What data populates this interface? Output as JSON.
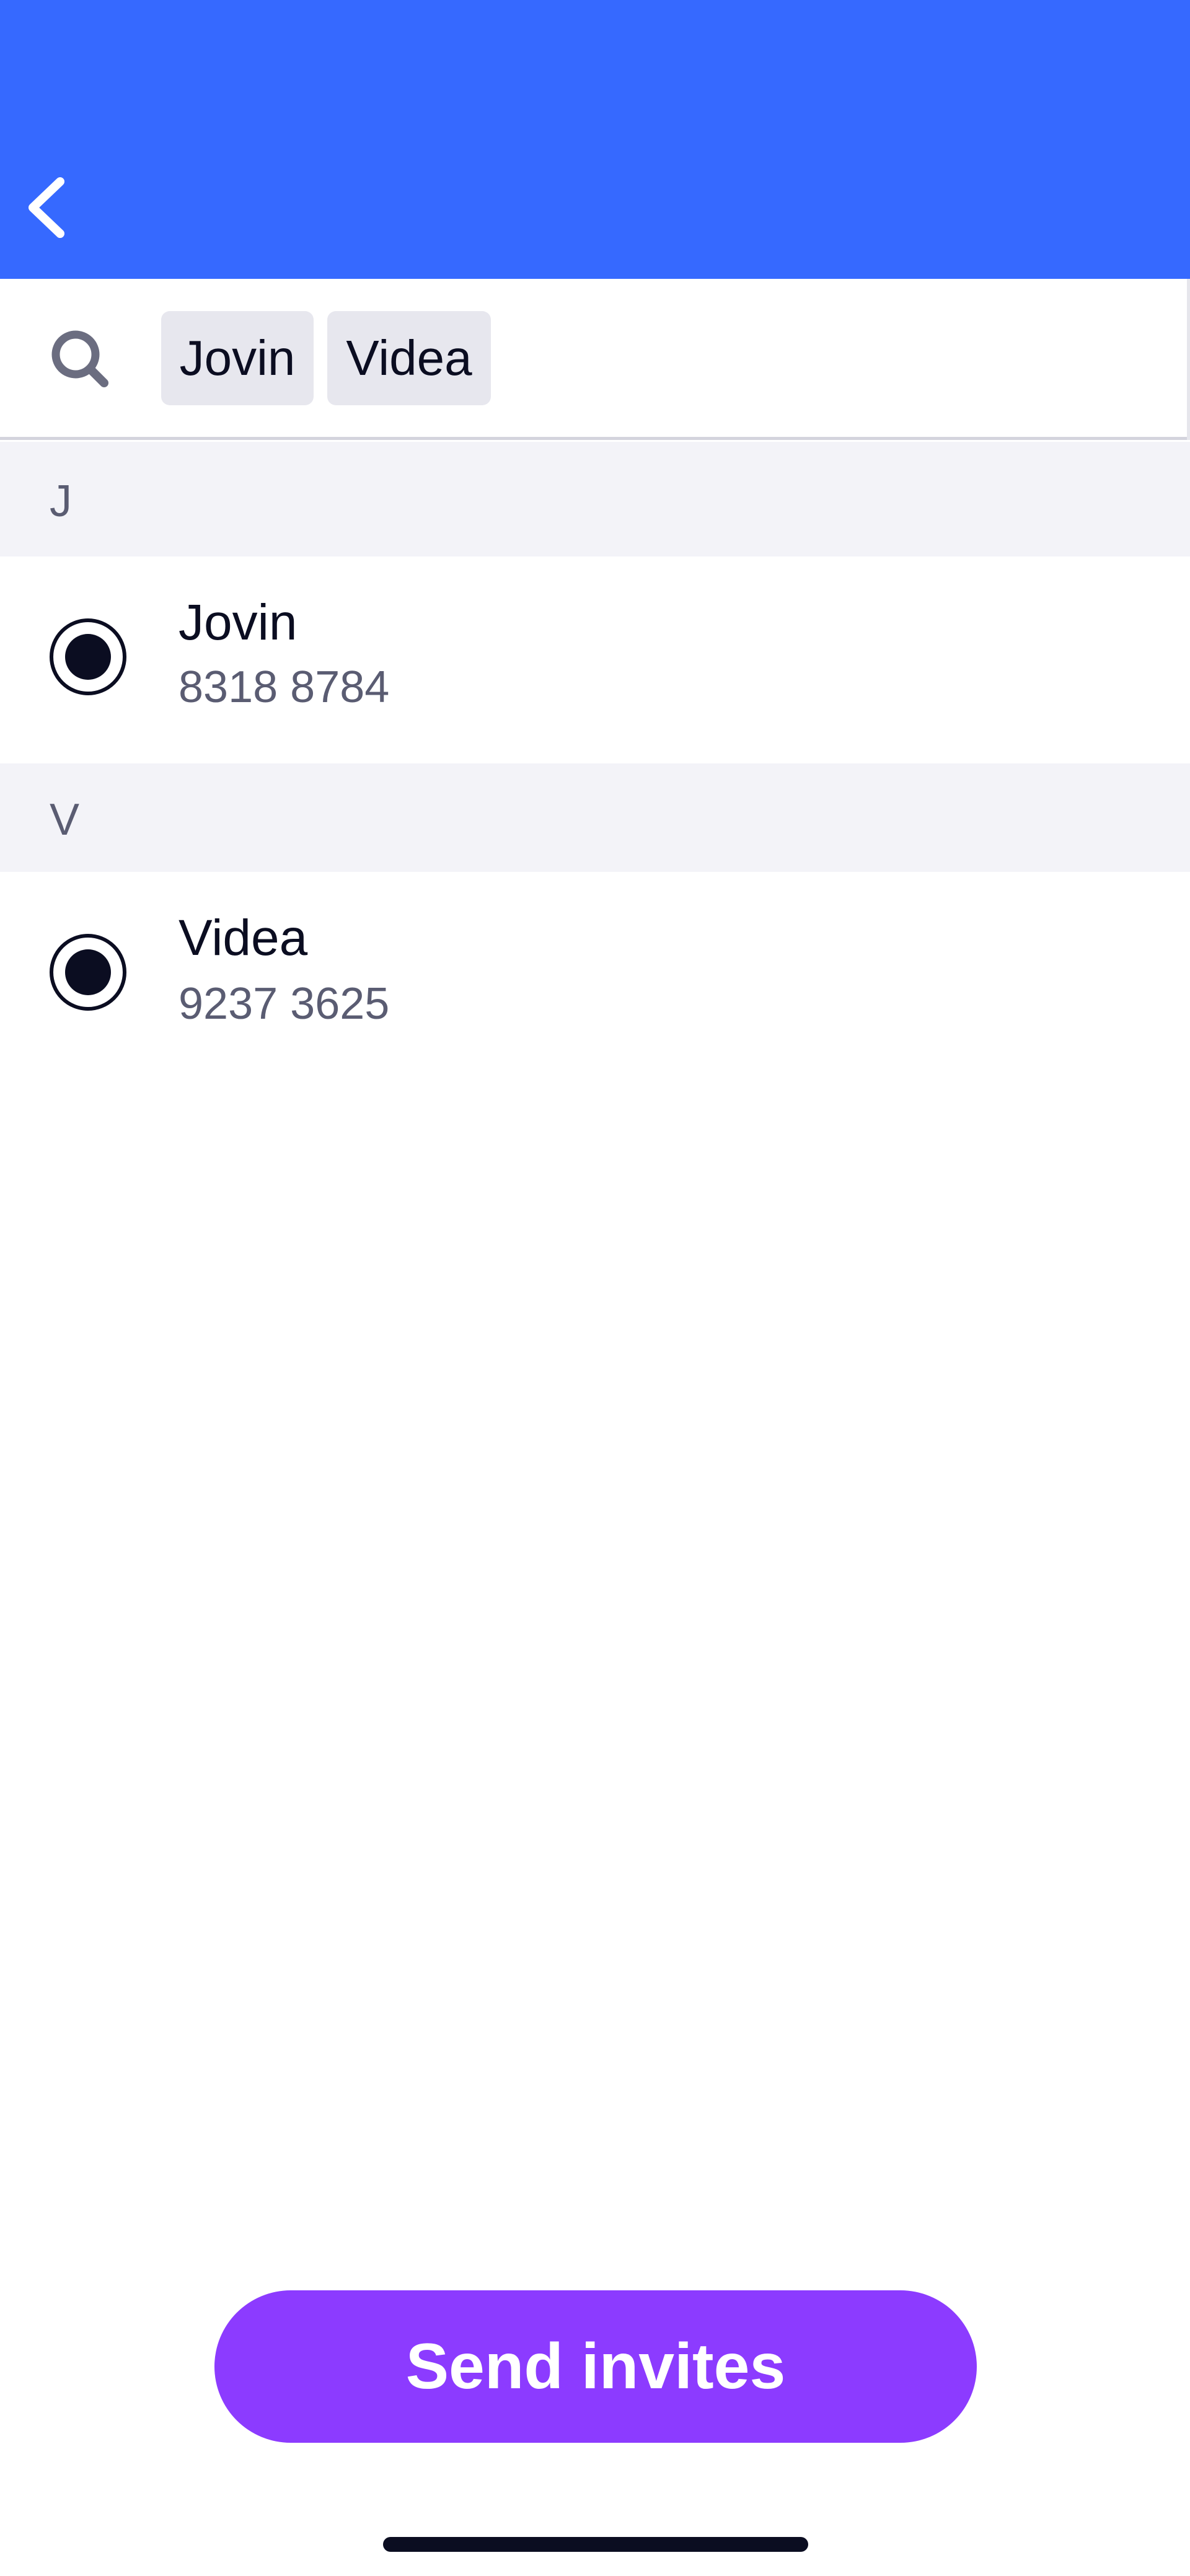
{
  "header": {
    "background_color": "#3669ff",
    "back_icon": "chevron-left-icon"
  },
  "search": {
    "icon": "search-icon",
    "chips": [
      "Jovin",
      "Videa"
    ]
  },
  "sections": [
    {
      "letter": "J",
      "contacts": [
        {
          "name": "Jovin",
          "phone": "8318 8784",
          "selected": true
        }
      ]
    },
    {
      "letter": "V",
      "contacts": [
        {
          "name": "Videa",
          "phone": "9237 3625",
          "selected": true
        }
      ]
    }
  ],
  "actions": {
    "send_label": "Send invites",
    "send_color": "#8c3bff"
  }
}
